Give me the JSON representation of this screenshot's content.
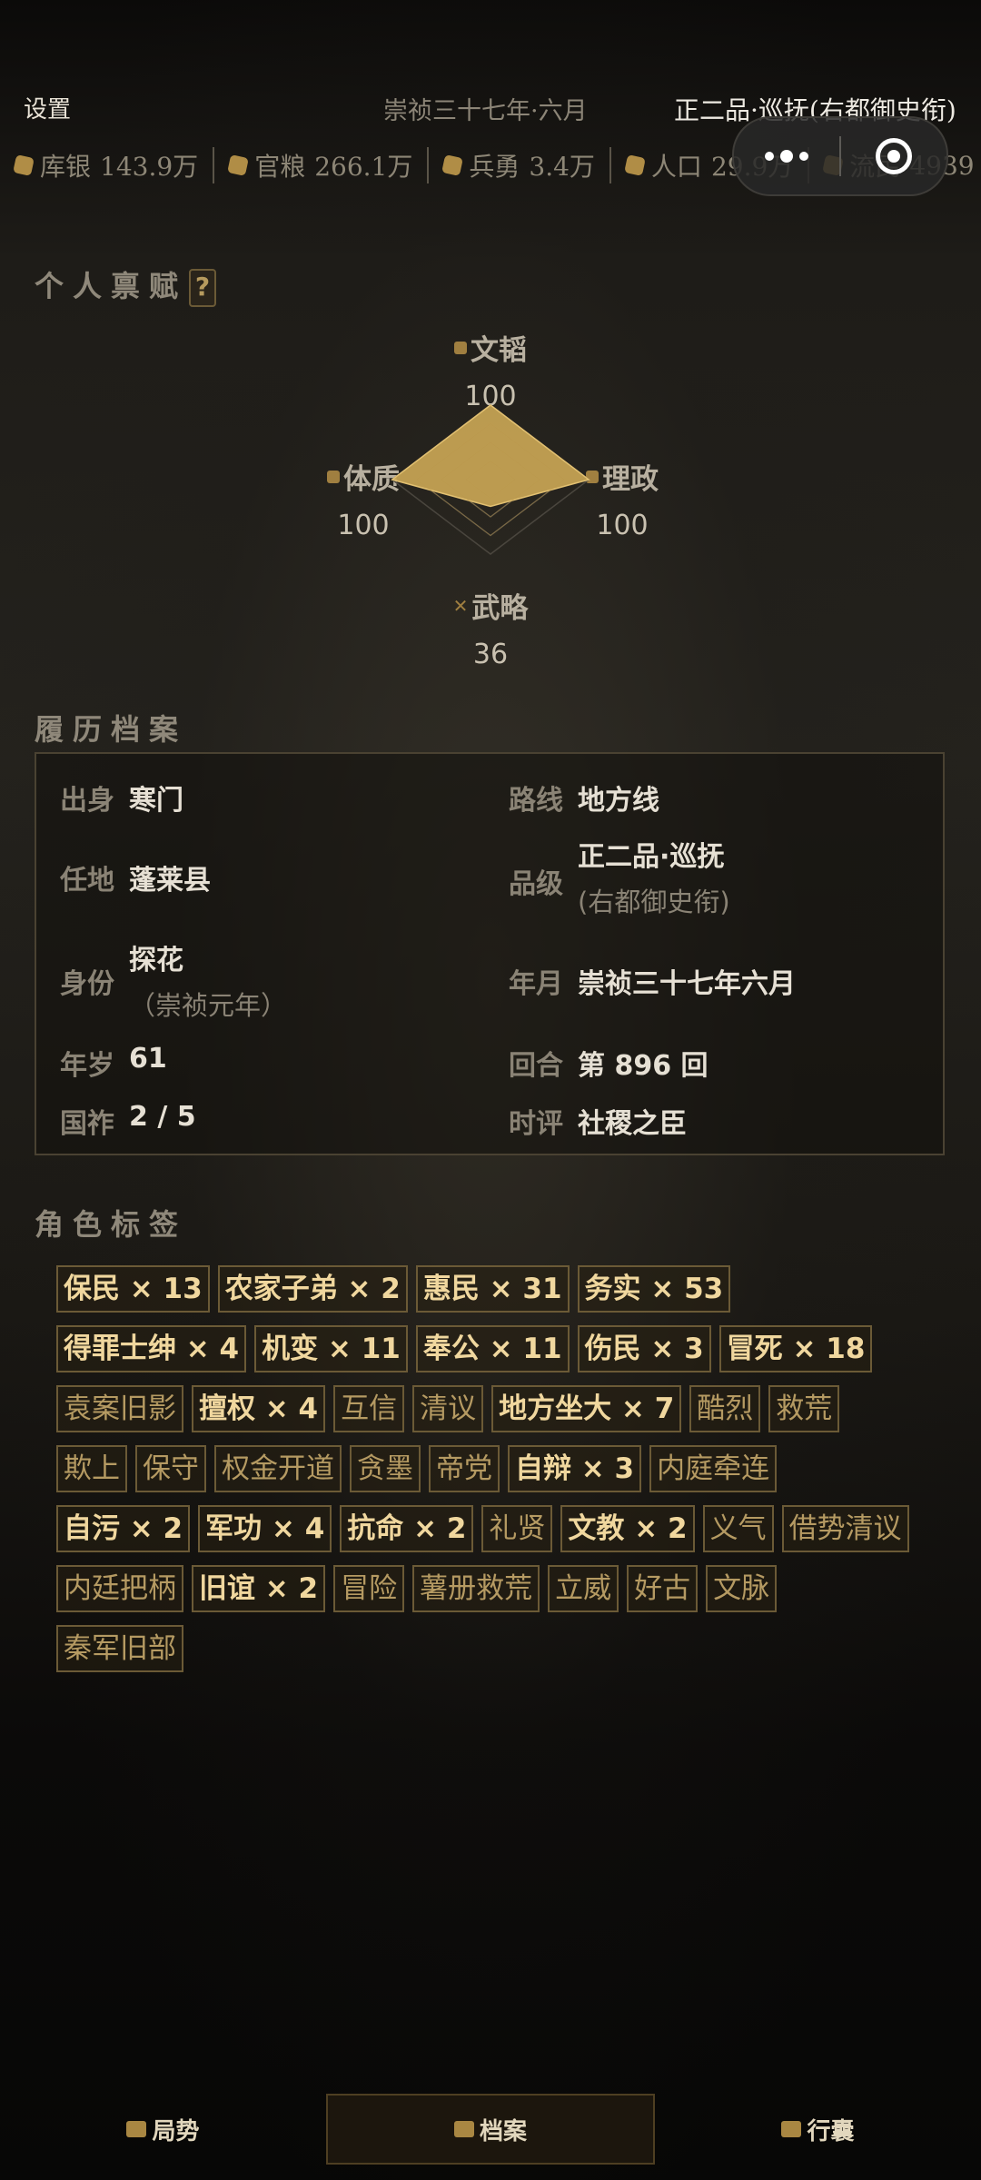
{
  "header": {
    "settings_label": "设置",
    "date": "崇祯三十七年·六月",
    "rank": "正二品·巡抚(右都御史衔)"
  },
  "resources": [
    {
      "icon": "coin-icon",
      "label": "库银",
      "value": "143.9万"
    },
    {
      "icon": "grain-icon",
      "label": "官粮",
      "value": "266.1万"
    },
    {
      "icon": "soldier-icon",
      "label": "兵勇",
      "value": "3.4万"
    },
    {
      "icon": "population-icon",
      "label": "人口",
      "value": "29.9万"
    },
    {
      "icon": "refugee-icon",
      "label": "流民",
      "value": "4939"
    }
  ],
  "talent": {
    "title": "个人禀赋",
    "help": "?",
    "max": 100,
    "stats": [
      {
        "key": "top",
        "name": "文韬",
        "value": 100
      },
      {
        "key": "right",
        "name": "理政",
        "value": 100
      },
      {
        "key": "bottom",
        "name": "武略",
        "value": 36
      },
      {
        "key": "left",
        "name": "体质",
        "value": 100
      }
    ],
    "colors": {
      "fill": "#c9a655",
      "grid": "#4a463e"
    }
  },
  "record": {
    "title": "履历档案",
    "items": [
      {
        "key": "出身",
        "value": "寒门"
      },
      {
        "key": "路线",
        "value": "地方线"
      },
      {
        "key": "任地",
        "value": "蓬莱县"
      },
      {
        "key": "品级",
        "value": "正二品·巡抚",
        "sub": "(右都御史衔)"
      },
      {
        "key": "身份",
        "value": "探花",
        "sub": "（崇祯元年）"
      },
      {
        "key": "年月",
        "value": "崇祯三十七年六月"
      },
      {
        "key": "年岁",
        "value": "61"
      },
      {
        "key": "回合",
        "value": "第 896 回"
      },
      {
        "key": "国祚",
        "value": "2 / 5"
      },
      {
        "key": "时评",
        "value": "社稷之臣"
      }
    ]
  },
  "tags": {
    "title": "角色标签",
    "items": [
      {
        "text": "保民 × 13",
        "strong": true
      },
      {
        "text": "农家子弟 × 2",
        "strong": true
      },
      {
        "text": "惠民 × 31",
        "strong": true
      },
      {
        "text": "务实 × 53",
        "strong": true
      },
      {
        "text": "得罪士绅 × 4",
        "strong": true
      },
      {
        "text": "机变 × 11",
        "strong": true
      },
      {
        "text": "奉公 × 11",
        "strong": true
      },
      {
        "text": "伤民 × 3",
        "strong": true
      },
      {
        "text": "冒死 × 18",
        "strong": true
      },
      {
        "text": "袁案旧影",
        "strong": false
      },
      {
        "text": "擅权 × 4",
        "strong": true
      },
      {
        "text": "互信",
        "strong": false
      },
      {
        "text": "清议",
        "strong": false
      },
      {
        "text": "地方坐大 × 7",
        "strong": true
      },
      {
        "text": "酷烈",
        "strong": false
      },
      {
        "text": "救荒",
        "strong": false
      },
      {
        "text": "欺上",
        "strong": false
      },
      {
        "text": "保守",
        "strong": false
      },
      {
        "text": "权金开道",
        "strong": false
      },
      {
        "text": "贪墨",
        "strong": false
      },
      {
        "text": "帝党",
        "strong": false
      },
      {
        "text": "自辩 × 3",
        "strong": true
      },
      {
        "text": "内庭牵连",
        "strong": false
      },
      {
        "text": "自污 × 2",
        "strong": true
      },
      {
        "text": "军功 × 4",
        "strong": true
      },
      {
        "text": "抗命 × 2",
        "strong": true
      },
      {
        "text": "礼贤",
        "strong": false
      },
      {
        "text": "文教 × 2",
        "strong": true
      },
      {
        "text": "义气",
        "strong": false
      },
      {
        "text": "借势清议",
        "strong": false
      },
      {
        "text": "内廷把柄",
        "strong": false
      },
      {
        "text": "旧谊 × 2",
        "strong": true
      },
      {
        "text": "冒险",
        "strong": false
      },
      {
        "text": "薯册救荒",
        "strong": false
      },
      {
        "text": "立威",
        "strong": false
      },
      {
        "text": "好古",
        "strong": false
      },
      {
        "text": "文脉",
        "strong": false
      },
      {
        "text": "秦军旧部",
        "strong": false
      }
    ]
  },
  "nav": {
    "items": [
      {
        "label": "局势",
        "icon": "situation-icon",
        "active": false
      },
      {
        "label": "档案",
        "icon": "archive-icon",
        "active": true
      },
      {
        "label": "行囊",
        "icon": "bag-icon",
        "active": false
      }
    ]
  }
}
